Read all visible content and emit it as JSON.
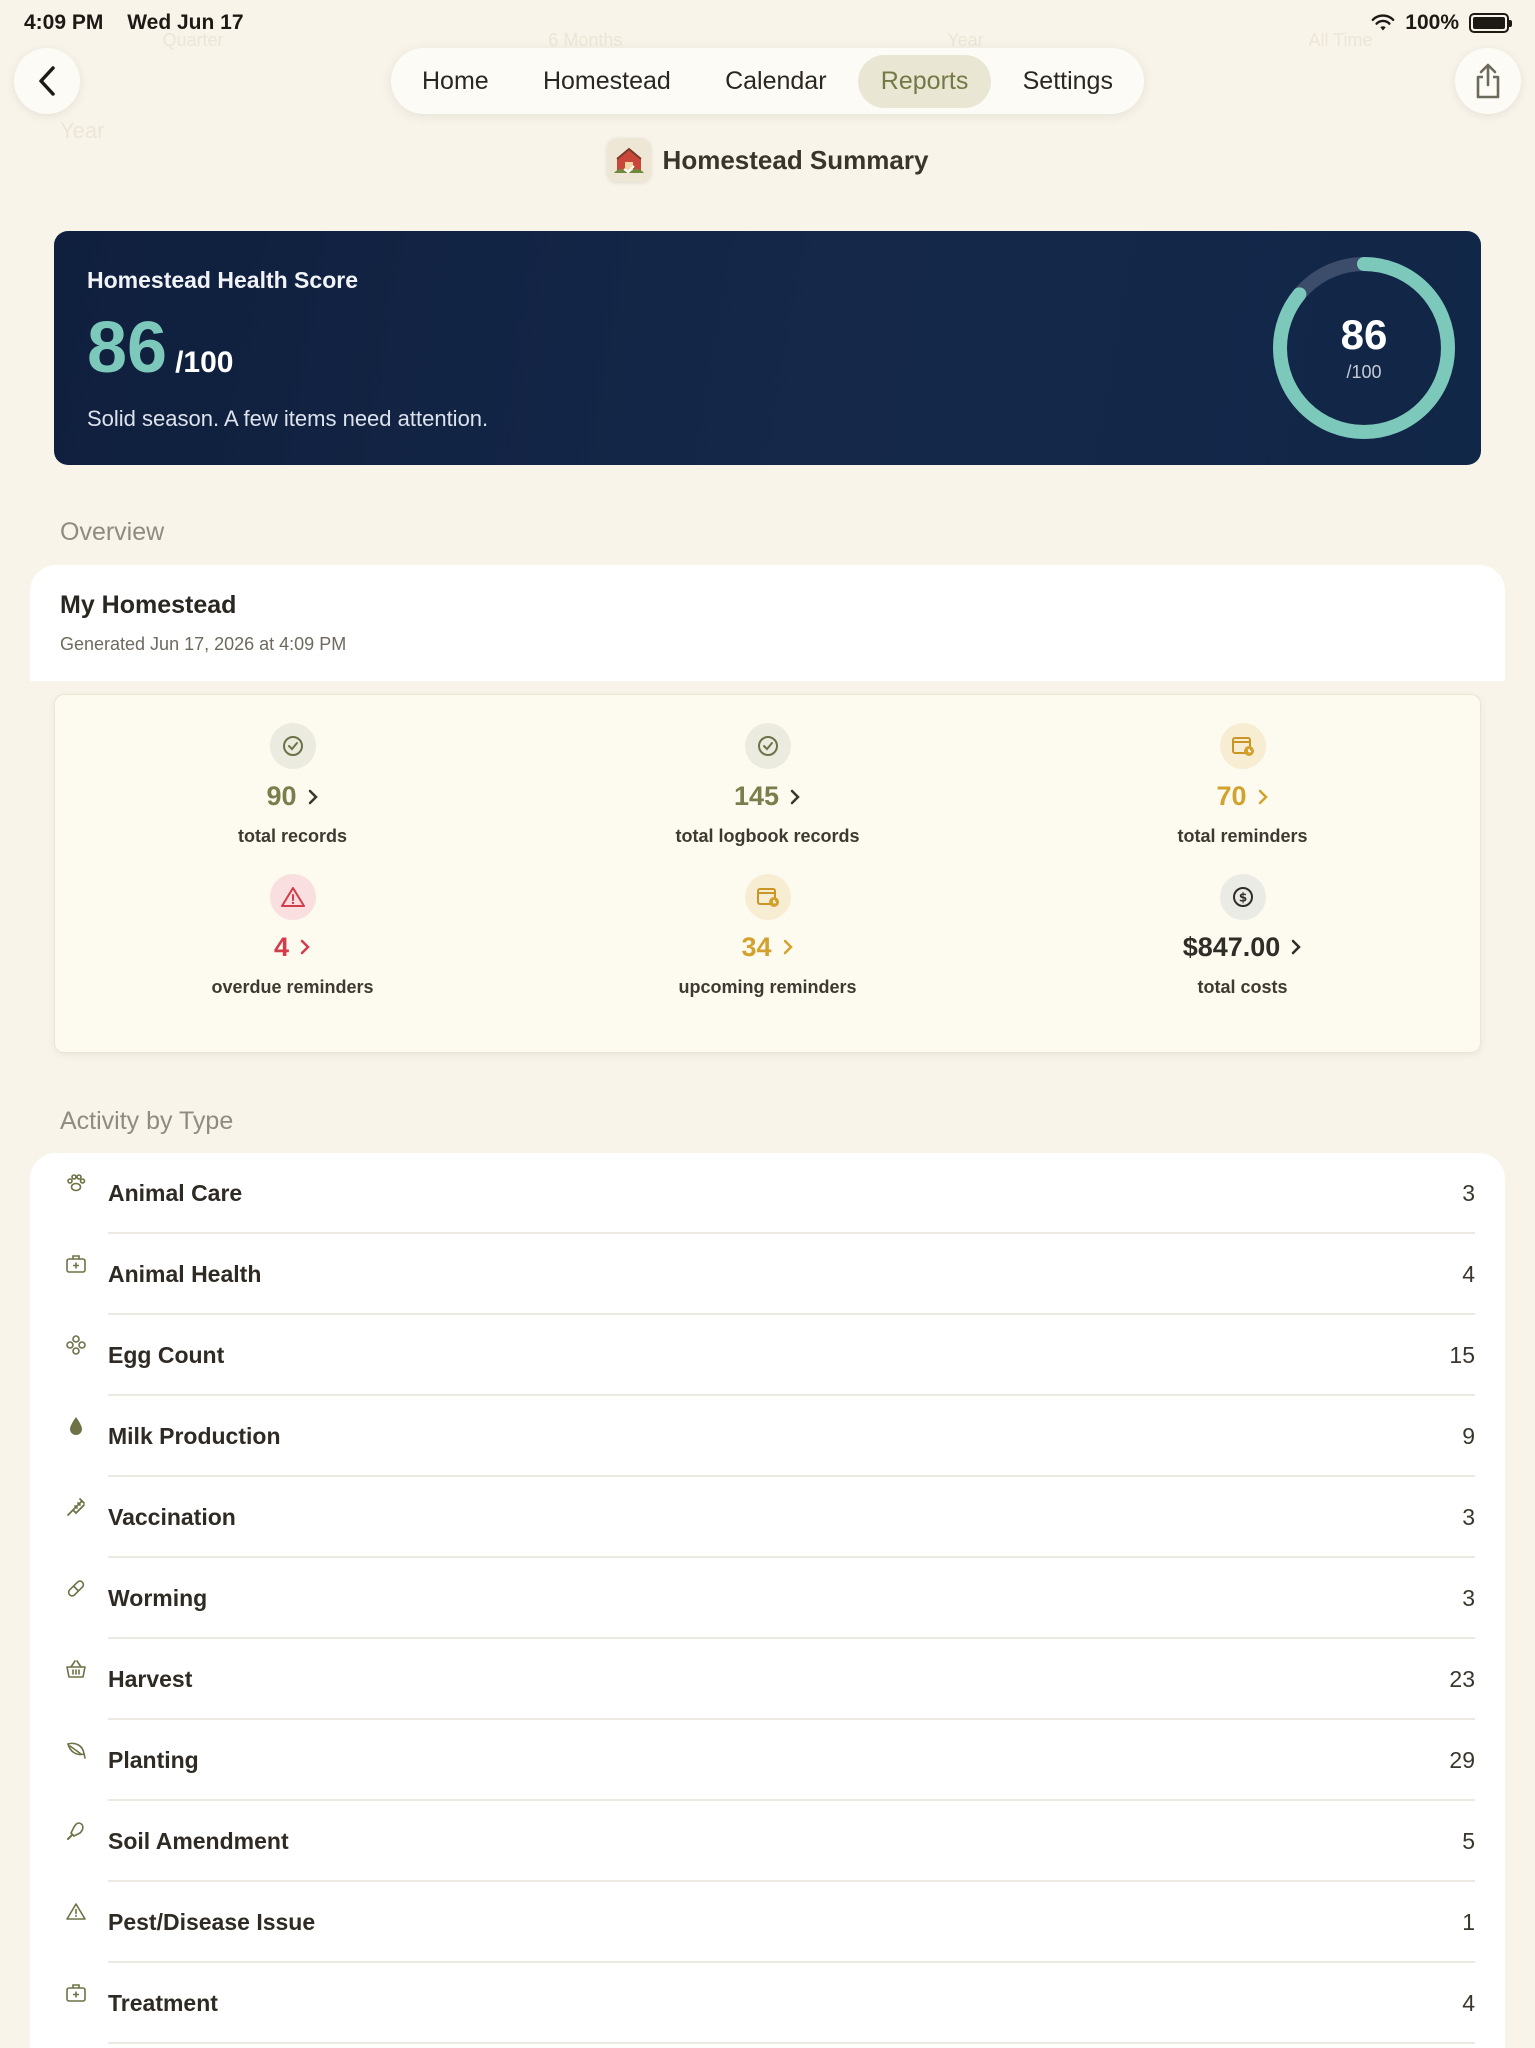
{
  "status": {
    "time": "4:09 PM",
    "date": "Wed Jun 17",
    "battery": "100%"
  },
  "nav": {
    "tabs": [
      "Home",
      "Homestead",
      "Calendar",
      "Reports",
      "Settings"
    ],
    "active": "Reports"
  },
  "header": {
    "title": "Homestead Summary"
  },
  "health": {
    "label": "Homestead Health Score",
    "score": "86",
    "denominator": "/100",
    "message": "Solid season. A few items need attention.",
    "score_fraction": 0.86
  },
  "overview": {
    "section_label": "Overview",
    "name": "My Homestead",
    "generated": "Generated Jun 17, 2026 at 4:09 PM"
  },
  "stats": [
    {
      "value": "90",
      "label": "total records",
      "icon": "check-circle-icon",
      "color": "#7a7e4c"
    },
    {
      "value": "145",
      "label": "total logbook records",
      "icon": "check-circle-icon",
      "color": "#7a7e4c"
    },
    {
      "value": "70",
      "label": "total reminders",
      "icon": "calendar-clock-icon",
      "color": "#d3a22e"
    },
    {
      "value": "4",
      "label": "overdue reminders",
      "icon": "warning-triangle-icon",
      "color": "#d33c4a"
    },
    {
      "value": "34",
      "label": "upcoming reminders",
      "icon": "calendar-clock-icon",
      "color": "#d3a22e"
    },
    {
      "value": "$847.00",
      "label": "total costs",
      "icon": "dollar-circle-icon",
      "color": "#2f2d27"
    }
  ],
  "activity": {
    "section_label": "Activity by Type",
    "items": [
      {
        "name": "Animal Care",
        "count": "3",
        "icon": "paw-icon"
      },
      {
        "name": "Animal Health",
        "count": "4",
        "icon": "medical-kit-icon"
      },
      {
        "name": "Egg Count",
        "count": "15",
        "icon": "egg-cluster-icon"
      },
      {
        "name": "Milk Production",
        "count": "9",
        "icon": "drop-icon"
      },
      {
        "name": "Vaccination",
        "count": "3",
        "icon": "syringe-icon"
      },
      {
        "name": "Worming",
        "count": "3",
        "icon": "pill-icon"
      },
      {
        "name": "Harvest",
        "count": "23",
        "icon": "basket-icon"
      },
      {
        "name": "Planting",
        "count": "29",
        "icon": "leaf-icon"
      },
      {
        "name": "Soil Amendment",
        "count": "5",
        "icon": "trowel-icon"
      },
      {
        "name": "Pest/Disease Issue",
        "count": "1",
        "icon": "warning-triangle-icon"
      },
      {
        "name": "Treatment",
        "count": "4",
        "icon": "medical-kit-icon"
      }
    ]
  },
  "background_ghost": {
    "periods": [
      "Quarter",
      "6 Months",
      "Year",
      "All Time"
    ],
    "year_label": "Year"
  }
}
